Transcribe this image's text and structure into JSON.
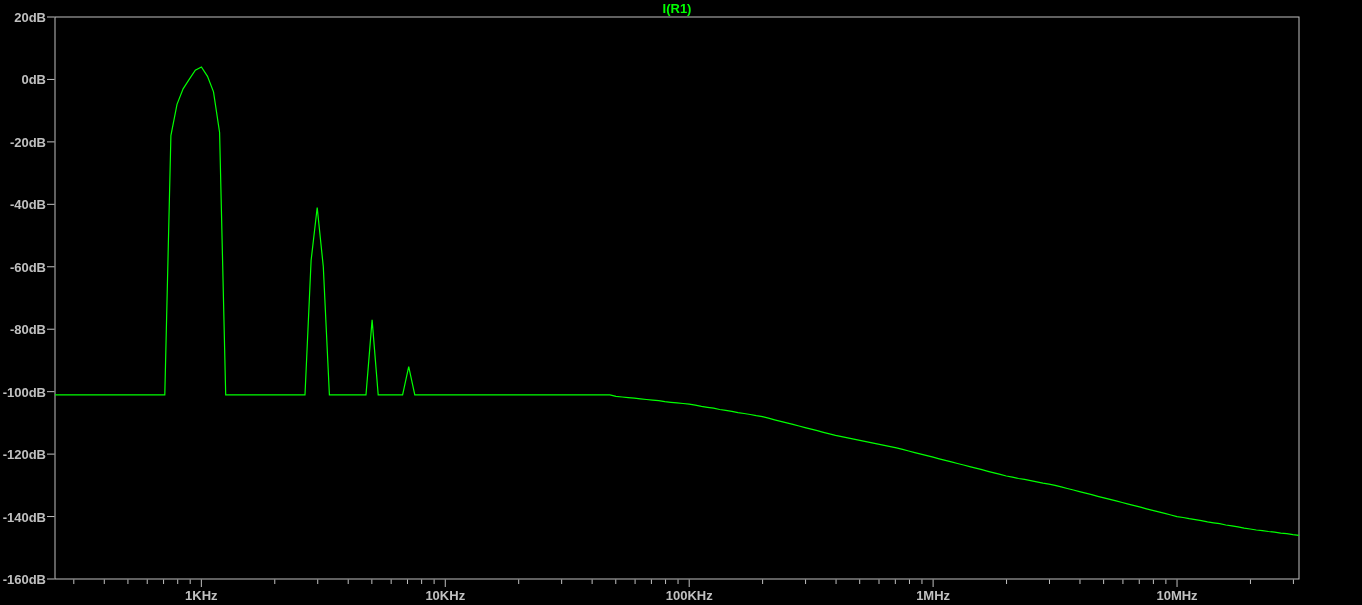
{
  "plot": {
    "chart_data": {
      "type": "line",
      "ylim": [
        -160,
        20
      ],
      "categories": [
        null,
        null,
        null,
        null,
        null,
        null,
        null,
        null,
        null,
        null,
        null,
        null,
        null,
        null,
        null,
        null,
        null,
        null,
        null,
        null,
        null,
        null,
        null,
        null,
        "1KHz",
        null,
        null,
        null,
        null,
        null,
        null,
        null,
        null,
        null,
        null,
        null,
        null,
        null,
        null,
        null,
        null,
        null,
        null,
        null,
        null,
        null,
        null,
        null,
        null,
        null,
        null,
        null,
        null,
        null,
        null,
        null,
        null,
        null,
        null,
        null,
        null,
        null,
        null,
        null,
        "10KHz",
        null,
        null,
        null,
        null,
        null,
        null,
        null,
        null,
        null,
        null,
        null,
        null,
        null,
        null,
        null,
        null,
        null,
        null,
        null,
        null,
        null,
        null,
        null,
        null,
        null,
        null,
        null,
        null,
        null,
        null,
        null,
        null,
        null,
        null,
        null,
        null,
        null,
        null,
        null,
        "100KHz",
        null,
        null,
        null,
        null,
        null,
        null,
        null,
        null,
        null,
        null,
        null,
        null,
        null,
        null,
        null,
        null,
        null,
        null,
        null,
        null,
        null,
        null,
        null,
        null,
        null,
        null,
        null,
        null,
        null,
        null,
        null,
        null,
        null,
        null,
        null,
        null,
        null,
        null,
        null,
        "1MHz",
        null,
        null,
        null,
        null,
        null,
        null,
        null,
        null,
        null,
        null,
        null,
        null,
        null,
        null,
        null,
        null,
        null,
        null,
        null,
        null,
        null,
        null,
        null,
        null,
        null,
        null,
        null,
        null,
        null,
        null,
        null,
        null,
        null,
        null,
        null,
        null,
        null,
        null,
        null,
        "10MHz",
        null,
        null,
        null,
        null,
        null,
        null,
        null,
        null,
        null,
        null,
        null,
        null,
        null,
        null,
        null,
        null,
        null,
        null,
        null,
        null
      ],
      "yticks": [
        {
          "value": 20,
          "label": "20dB"
        },
        {
          "value": 0,
          "label": "0dB"
        },
        {
          "value": -20,
          "label": "-20dB"
        },
        {
          "value": -40,
          "label": "-40dB"
        },
        {
          "value": -60,
          "label": "-60dB"
        },
        {
          "value": -80,
          "label": "-80dB"
        },
        {
          "value": -100,
          "label": "-100dB"
        },
        {
          "value": -120,
          "label": "-120dB"
        },
        {
          "value": -140,
          "label": "-140dB"
        },
        {
          "value": -160,
          "label": "-160dB"
        }
      ],
      "series": [
        {
          "name": "I(R1)",
          "color": "#00ff00",
          "values": [
            -101,
            -101,
            -101,
            -101,
            -101,
            -101,
            -101,
            -101,
            -101,
            -101,
            -101,
            -101,
            -101,
            -101,
            -101,
            -101,
            -101,
            -101,
            -101,
            -18,
            -8,
            -3,
            0,
            3,
            4,
            1,
            -4,
            -17,
            -101,
            -101,
            -101,
            -101,
            -101,
            -101,
            -101,
            -101,
            -101,
            -101,
            -101,
            -101,
            -101,
            -101,
            -58,
            -41,
            -60,
            -101,
            -101,
            -101,
            -101,
            -101,
            -101,
            -101,
            -77,
            -101,
            -101,
            -101,
            -101,
            -101,
            -92,
            -101,
            -101,
            -101,
            -101,
            -101,
            -101,
            -101,
            -101,
            -101,
            -101,
            -101,
            -101,
            -101,
            -101,
            -101,
            -101,
            -101,
            -101,
            -101,
            -101,
            -101,
            -101,
            -101,
            -101,
            -101,
            -101,
            -101,
            -101,
            -101,
            -101,
            -101,
            -101,
            -101,
            -101.5,
            -101.7,
            -101.9,
            -102.1,
            -102.3,
            -102.5,
            -102.7,
            -102.9,
            -103.2,
            -103.4,
            -103.6,
            -103.8,
            -104,
            -104.3,
            -104.7,
            -105,
            -105.3,
            -105.7,
            -106,
            -106.3,
            -106.7,
            -107,
            -107.3,
            -107.7,
            -108,
            -108.5,
            -109,
            -109.5,
            -110,
            -110.5,
            -111,
            -111.5,
            -112,
            -112.5,
            -113,
            -113.5,
            -114,
            -114.4,
            -114.8,
            -115.2,
            -115.6,
            -116,
            -116.4,
            -116.8,
            -117.2,
            -117.6,
            -118,
            -118.5,
            -119,
            -119.5,
            -120,
            -120.5,
            -121,
            -121.5,
            -122,
            -122.5,
            -123,
            -123.5,
            -124,
            -124.5,
            -125,
            -125.5,
            -126,
            -126.5,
            -127,
            -127.4,
            -127.8,
            -128.1,
            -128.5,
            -128.9,
            -129.3,
            -129.6,
            -130,
            -130.5,
            -131,
            -131.5,
            -132,
            -132.5,
            -133,
            -133.5,
            -134,
            -134.5,
            -135,
            -135.5,
            -136,
            -136.5,
            -137,
            -137.5,
            -138,
            -138.5,
            -139,
            -139.5,
            -140,
            -140.3,
            -140.7,
            -141,
            -141.3,
            -141.7,
            -142,
            -142.3,
            -142.7,
            -143,
            -143.3,
            -143.7,
            -144,
            -144.3,
            -144.5,
            -144.8,
            -145,
            -145.3,
            -145.5,
            -145.8,
            -146
          ]
        }
      ]
    }
  }
}
